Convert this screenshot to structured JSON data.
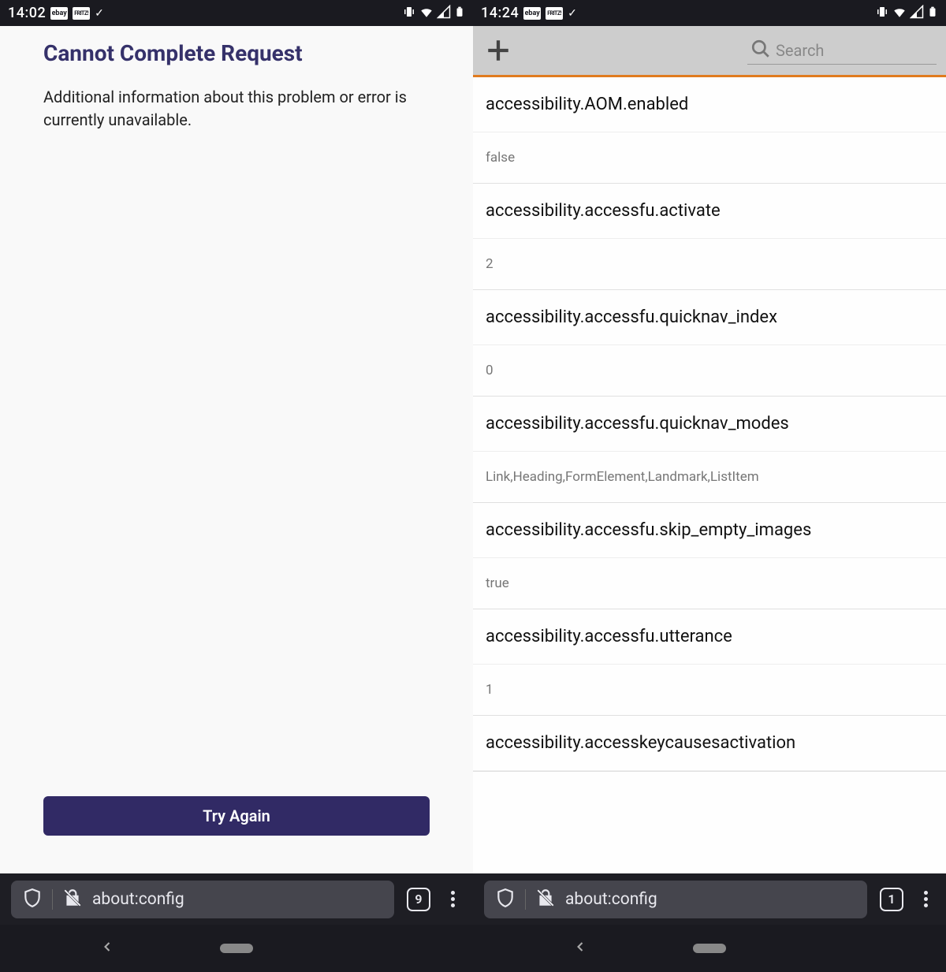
{
  "left": {
    "status": {
      "time": "14:02",
      "icons": [
        "ebay",
        "FRITZ!",
        "✓"
      ]
    },
    "error": {
      "title": "Cannot Complete Request",
      "message": "Additional information about this problem or error is currently unavailable.",
      "button": "Try Again"
    },
    "browser": {
      "url": "about:config",
      "tab_count": "9"
    }
  },
  "right": {
    "status": {
      "time": "14:24",
      "icons": [
        "ebay",
        "FRITZ!",
        "✓"
      ]
    },
    "search_placeholder": "Search",
    "prefs": [
      {
        "key": "accessibility.AOM.enabled",
        "value": "false"
      },
      {
        "key": "accessibility.accessfu.activate",
        "value": "2"
      },
      {
        "key": "accessibility.accessfu.quicknav_index",
        "value": "0"
      },
      {
        "key": "accessibility.accessfu.quicknav_modes",
        "value": "Link,Heading,FormElement,Landmark,ListItem"
      },
      {
        "key": "accessibility.accessfu.skip_empty_images",
        "value": "true"
      },
      {
        "key": "accessibility.accessfu.utterance",
        "value": "1"
      },
      {
        "key": "accessibility.accesskeycausesactivation",
        "value": ""
      }
    ],
    "browser": {
      "url": "about:config",
      "tab_count": "1"
    }
  }
}
